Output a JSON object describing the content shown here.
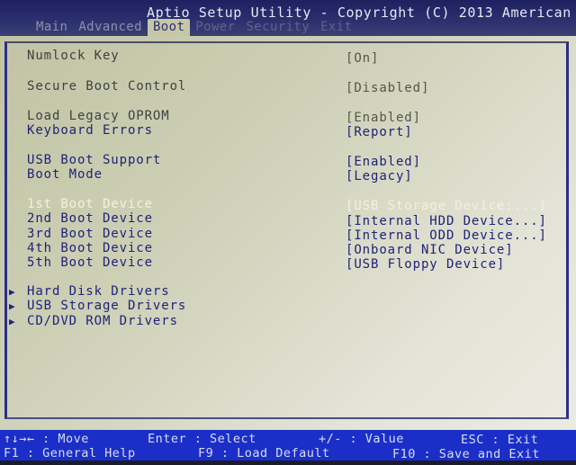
{
  "header": {
    "title": "Aptio Setup Utility - Copyright (C) 2013 American",
    "tabs": [
      {
        "label": "Main",
        "state": "inactive"
      },
      {
        "label": "Advanced",
        "state": "inactive"
      },
      {
        "label": "Boot",
        "state": "active"
      },
      {
        "label": "Power",
        "state": "disabled"
      },
      {
        "label": "Security",
        "state": "disabled"
      },
      {
        "label": "Exit",
        "state": "disabled"
      }
    ]
  },
  "settings": [
    {
      "label": "Numlock Key",
      "value": "[On]"
    },
    {
      "label": "Secure Boot Control",
      "value": "[Disabled]"
    },
    {
      "label": "Load Legacy OPROM",
      "value": "[Enabled]"
    },
    {
      "label": "Keyboard Errors",
      "value": "[Report]"
    },
    {
      "label": "USB Boot Support",
      "value": "[Enabled]"
    },
    {
      "label": "Boot Mode",
      "value": "[Legacy]"
    },
    {
      "label": "1st Boot Device",
      "value": "[USB Storage Device:...]",
      "selected": true
    },
    {
      "label": "2nd Boot Device",
      "value": "[Internal HDD Device...]"
    },
    {
      "label": "3rd Boot Device",
      "value": "[Internal ODD Device...]"
    },
    {
      "label": "4th Boot Device",
      "value": "[Onboard NIC Device]"
    },
    {
      "label": "5th Boot Device",
      "value": "[USB Floppy Device]"
    }
  ],
  "submenus": [
    {
      "label": "Hard Disk Drivers",
      "icon": "triangle-right-icon"
    },
    {
      "label": "USB Storage Drivers",
      "icon": "triangle-right-icon"
    },
    {
      "label": "CD/DVD ROM Drivers",
      "icon": "triangle-right-icon"
    }
  ],
  "submenu_arrow": "▶",
  "footer": {
    "move": "↑↓→← : Move",
    "select": "Enter : Select",
    "value": "+/- : Value",
    "esc": "ESC : Exit",
    "help": "F1 : General Help",
    "default": "F9 : Load Default",
    "save": "F10 : Save and Exit"
  },
  "colors": {
    "header_bg": "#1e2160",
    "panel_bg": "#cfd1b8",
    "footer_bg": "#1b2fc8",
    "selected_text": "#f4f1dc",
    "option_text": "#1e2378"
  }
}
